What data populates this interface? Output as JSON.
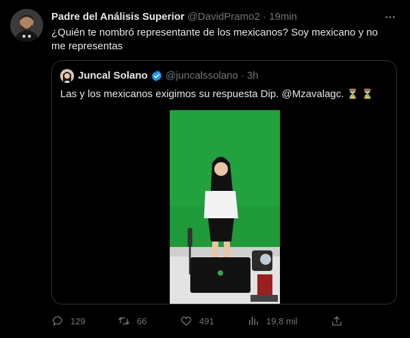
{
  "tweet": {
    "author_name": "Padre del Análisis Superior",
    "handle": "@DavidPramo2",
    "separator": "·",
    "time": "19min",
    "text": "¿Quién te nombró representante de los mexicanos? Soy mexicano y no me representas"
  },
  "quoted": {
    "author_name": "Juncal Solano",
    "handle": "@juncalssolano",
    "separator": "·",
    "time": "3h",
    "text": "Las y los mexicanos exigimos su respuesta Dip.  @Mzavalagc.",
    "emoji": "⏳ ⏳"
  },
  "actions": {
    "replies": "129",
    "retweets": "66",
    "likes": "491",
    "views": "19,8 mil"
  },
  "colors": {
    "background": "#000000",
    "text": "#e7e9ea",
    "muted": "#71767b",
    "verified": "#1d9bf0",
    "green_screen": "#1f9a3a"
  },
  "icons": [
    "more-icon",
    "verified-badge-icon",
    "reply-icon",
    "retweet-icon",
    "like-icon",
    "views-icon",
    "share-icon"
  ]
}
